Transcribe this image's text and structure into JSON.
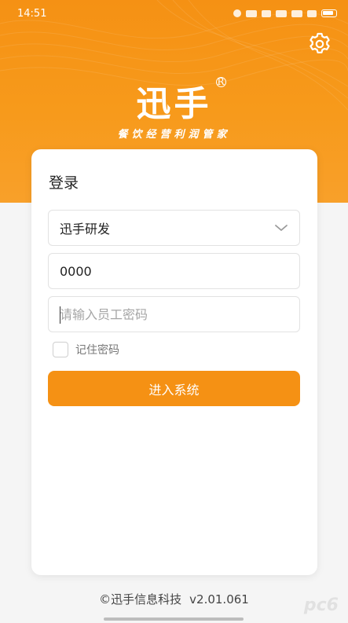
{
  "status_bar": {
    "time": "14:51"
  },
  "header": {
    "logo_text": "迅手",
    "registered_mark": "R",
    "slogan": "餐饮经营利润管家",
    "settings_icon": "gear-icon",
    "brand_color": "#f59114"
  },
  "login_card": {
    "title": "登录",
    "store_select": {
      "value": "迅手研发",
      "icon": "chevron-down-icon"
    },
    "employee_id": {
      "value": "0000"
    },
    "password": {
      "placeholder": "请输入员工密码",
      "value": ""
    },
    "remember": {
      "label": "记住密码",
      "checked": false
    },
    "submit_label": "进入系统"
  },
  "footer": {
    "copyright": "©迅手信息科技",
    "version": "v2.01.061"
  },
  "watermark": "pc6"
}
